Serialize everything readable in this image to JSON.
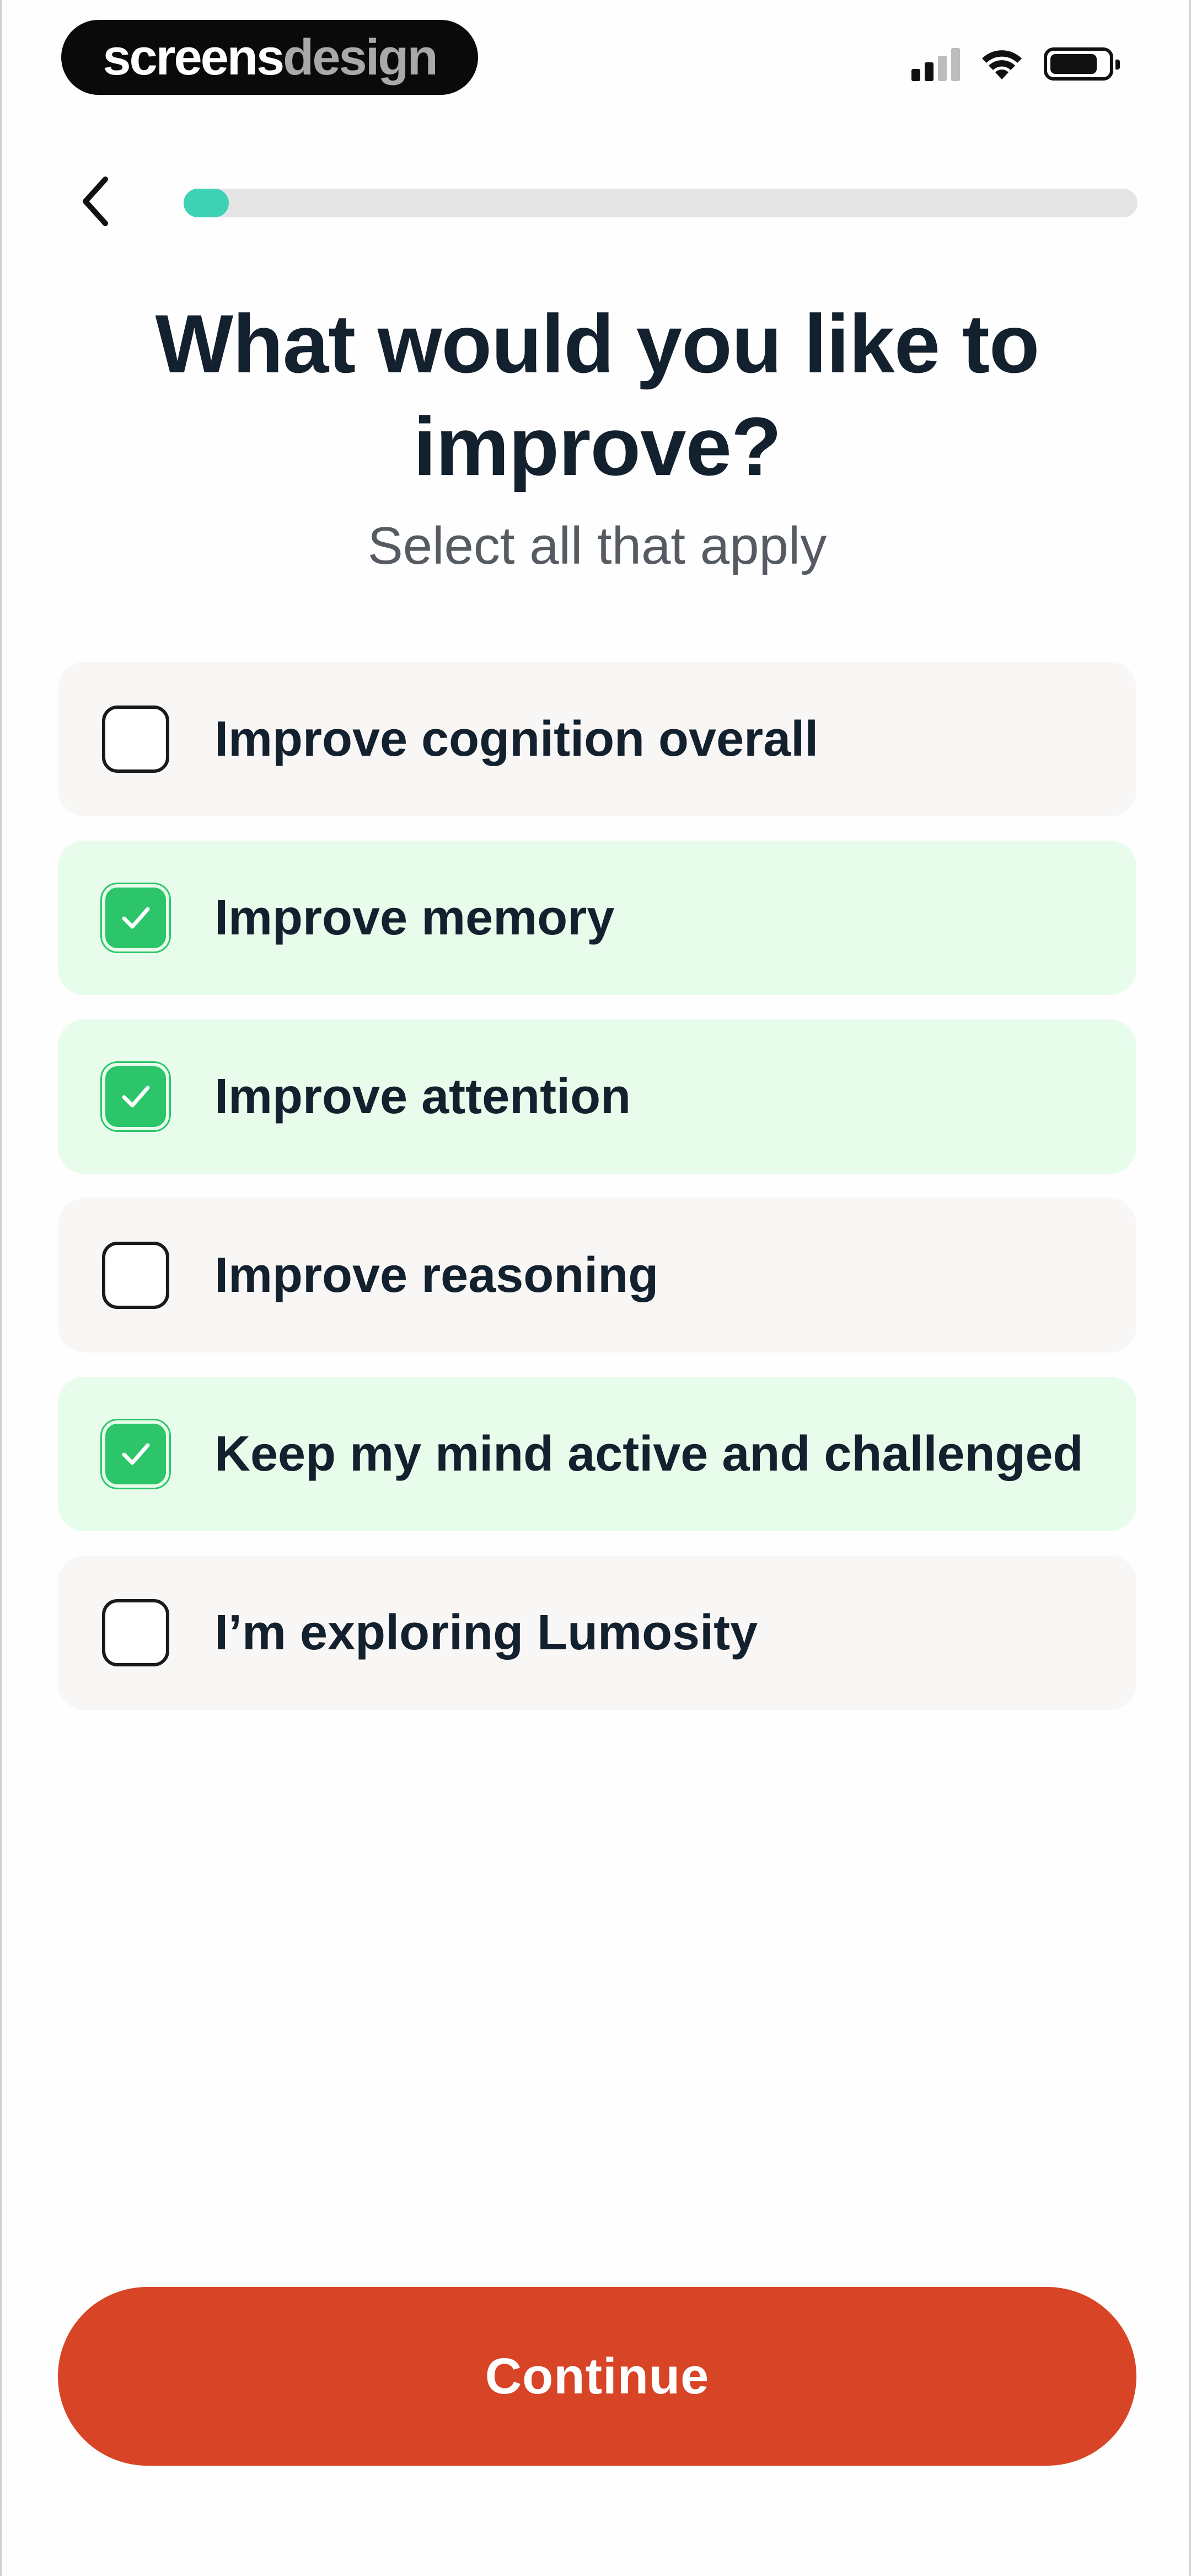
{
  "status_bar": {
    "brand_part1": "screens",
    "brand_part2": "design",
    "icons": [
      "signal-icon",
      "wifi-icon",
      "battery-icon"
    ]
  },
  "header": {
    "back_icon": "chevron-left-icon",
    "progress_fraction": 0.04
  },
  "question": {
    "title": "What would you like to improve?",
    "subtitle": "Select all that apply"
  },
  "options": [
    {
      "label": "Improve cognition overall",
      "checked": false
    },
    {
      "label": "Improve memory",
      "checked": true
    },
    {
      "label": "Improve attention",
      "checked": true
    },
    {
      "label": "Improve reasoning",
      "checked": false
    },
    {
      "label": "Keep my mind active and challenged",
      "checked": true
    },
    {
      "label": "I’m exploring Lumosity",
      "checked": false
    }
  ],
  "footer": {
    "continue_label": "Continue"
  },
  "colors": {
    "accent_button": "#d84526",
    "progress": "#3fd1b4",
    "check_green": "#2cc56a",
    "selected_bg": "#e8fcec",
    "unselected_bg": "#f8f7f5",
    "text_dark": "#13202d"
  }
}
